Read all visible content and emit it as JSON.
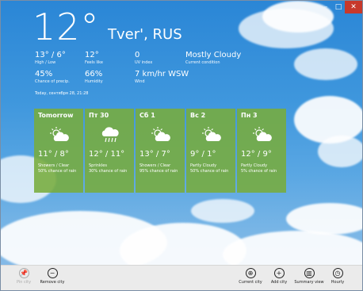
{
  "current": {
    "temperature": "12°",
    "city": "Tver', RUS"
  },
  "metrics": [
    {
      "value": "13° / 6°",
      "label": "High / Low"
    },
    {
      "value": "12°",
      "label": "Feels like"
    },
    {
      "value": "0",
      "label": "UV index"
    },
    {
      "value": "Mostly Cloudy",
      "label": "Current condition"
    },
    {
      "value": "45%",
      "label": "Chance of precip."
    },
    {
      "value": "66%",
      "label": "Humidity"
    },
    {
      "value": "7 km/hr WSW",
      "label": "Wind"
    }
  ],
  "timestamp": "Today, сентября 28, 21:28",
  "forecast": [
    {
      "day": "Tomorrow",
      "icon": "sun-cloud-icon",
      "temps": "11° / 8°",
      "condition": "Showers / Clear",
      "precip": "50% chance of rain"
    },
    {
      "day": "Пт 30",
      "icon": "rain-cloud-icon",
      "temps": "12° / 11°",
      "condition": "Sprinkles",
      "precip": "30% chance of rain"
    },
    {
      "day": "Сб 1",
      "icon": "sun-cloud-icon",
      "temps": "13° / 7°",
      "condition": "Showers / Clear",
      "precip": "95% chance of rain"
    },
    {
      "day": "Вс 2",
      "icon": "sun-cloud-icon",
      "temps": "9° / 1°",
      "condition": "Partly Cloudy",
      "precip": "50% chance of rain"
    },
    {
      "day": "Пн 3",
      "icon": "sun-cloud-icon",
      "temps": "12° / 9°",
      "condition": "Partly Cloudy",
      "precip": "5% chance of rain"
    }
  ],
  "appbar": {
    "pin_city": "Pin city",
    "remove_city": "Remove city",
    "current_city": "Current city",
    "add_city": "Add city",
    "summary_view": "Summary view",
    "hourly": "Hourly"
  },
  "window_controls": {
    "minimize": "–",
    "maximize": "□",
    "close": "✕"
  },
  "colors": {
    "tile": "#77ac3c",
    "appbar": "#ebebeb",
    "close": "#c7392b"
  }
}
